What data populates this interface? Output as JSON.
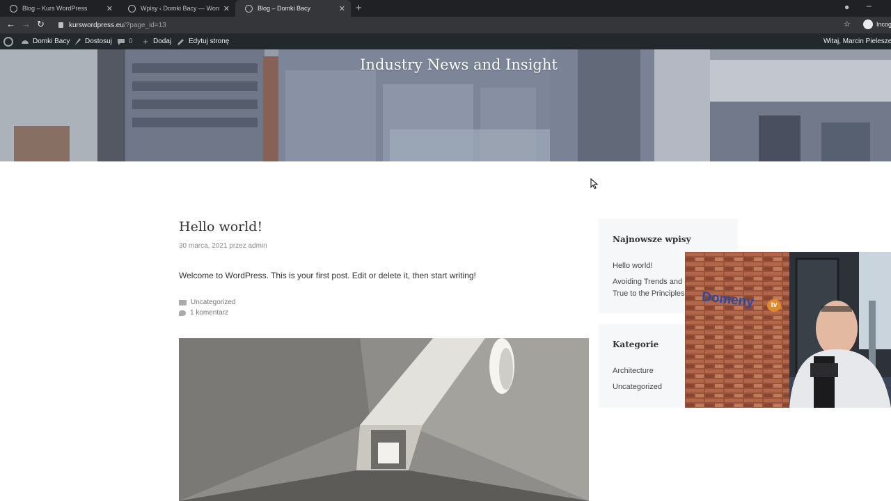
{
  "browser": {
    "tabs": [
      {
        "label": "Blog – Kurs WordPress",
        "active": false
      },
      {
        "label": "Wpisy ‹ Domki Bacy — WordPress",
        "active": false
      },
      {
        "label": "Blog – Domki Bacy",
        "active": true
      }
    ],
    "new_tab": "+",
    "url_host": "kurswordpress.eu",
    "url_path": "/?page_id=13",
    "incognito_label": "Incog"
  },
  "admin_bar": {
    "site_name": "Domki Bacy",
    "customize": "Dostosuj",
    "comments_count": "0",
    "add_new": "Dodaj",
    "edit_page": "Edytuj stronę",
    "greeting": "Witaj, Marcin Pieleszek"
  },
  "hero": {
    "title": "Industry News and Insight"
  },
  "post": {
    "title": "Hello world!",
    "meta": "30 marca, 2021 przez admin",
    "body": "Welcome to WordPress. This is your first post. Edit or delete it, then start writing!",
    "category": "Uncategorized",
    "comments": "1 komentarz"
  },
  "sidebar": {
    "recent_title": "Najnowsze wpisy",
    "recent_posts": [
      "Hello world!",
      "Avoiding Trends and S",
      "True to the Principles"
    ],
    "categories_title": "Kategorie",
    "categories": [
      "Architecture",
      "Uncategorized"
    ]
  },
  "webcam": {
    "sign_text": "Domeny",
    "sign_badge": "tv"
  },
  "colors": {
    "adminbar_bg": "#23282d",
    "tabstrip_bg": "#202124",
    "toolbar_bg": "#35363a",
    "widget_bg": "#f5f7f8"
  }
}
